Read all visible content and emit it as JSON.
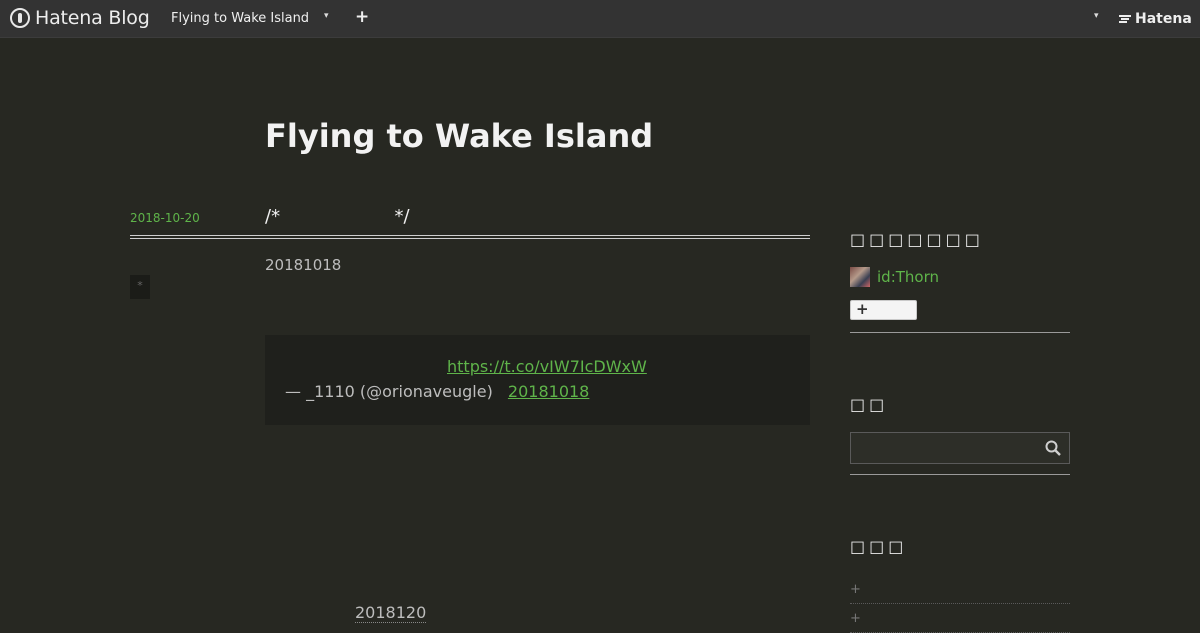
{
  "topbar": {
    "brand": "Hatena Blog",
    "blog_name": "Flying to Wake Island",
    "caret": "▾",
    "plus": "+",
    "hatena": "Hatena"
  },
  "blog": {
    "title": "Flying to Wake Island"
  },
  "entry": {
    "date": "2018-10-20",
    "title": "/*                    */",
    "body_date": "20181018",
    "star": "*",
    "tweet": {
      "link": "https://t.co/vIW7IcDWxW",
      "by": "— _1110 (@orionaveugle)",
      "date": "20181018"
    },
    "next_date": "2018120"
  },
  "sidebar": {
    "profile_heading": "□□□□□□□",
    "profile_id": "id:Thorn",
    "follow_plus": "+",
    "search_heading": "□□",
    "categories_heading": "□□□",
    "category_items": [
      "+",
      "+"
    ]
  },
  "colors": {
    "background": "#272822",
    "link": "#5fb44a",
    "topbar": "#333333"
  }
}
